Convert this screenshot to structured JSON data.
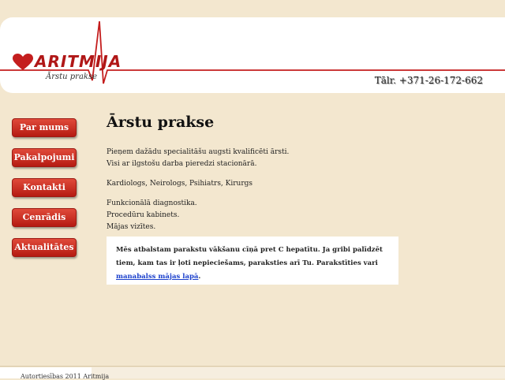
{
  "header": {
    "logo_text": "ARITMIJA",
    "logo_sub": "Ārstu prakse",
    "phone": "Tālr. +371-26-172-662"
  },
  "nav": {
    "items": [
      {
        "label": "Par mums"
      },
      {
        "label": "Pakalpojumi"
      },
      {
        "label": "Kontakti"
      },
      {
        "label": "Cenrādis"
      },
      {
        "label": "Aktualitātes"
      }
    ]
  },
  "main": {
    "title": "Ārstu prakse",
    "p1_line1": "Pieņem dažādu specialitāšu augsti kvalificēti ārsti.",
    "p1_line2": "Visi ar ilgstošu darba pieredzi stacionārā.",
    "p2_line1": "Kardiologs, Neirologs, Psihiatrs, Kirurgs",
    "p3_line1": "Funkcionālā diagnostika.",
    "p3_line2": "Procedūru kabinets.",
    "p3_line3": "Mājas vizītes."
  },
  "notice": {
    "text": "Mēs atbalstam parakstu vākšanu cīņā pret C hepatītu. Ja gribi palīdzēt tiem, kam tas ir ļoti nepieciešams, paraksties arī Tu. Parakstīties vari ",
    "link_text": "manabalss mājas lapā",
    "after": "."
  },
  "footer": {
    "text": "Autortiesības 2011 Aritmija"
  },
  "colors": {
    "accent": "#c0392b",
    "background": "#f3e7cf"
  }
}
